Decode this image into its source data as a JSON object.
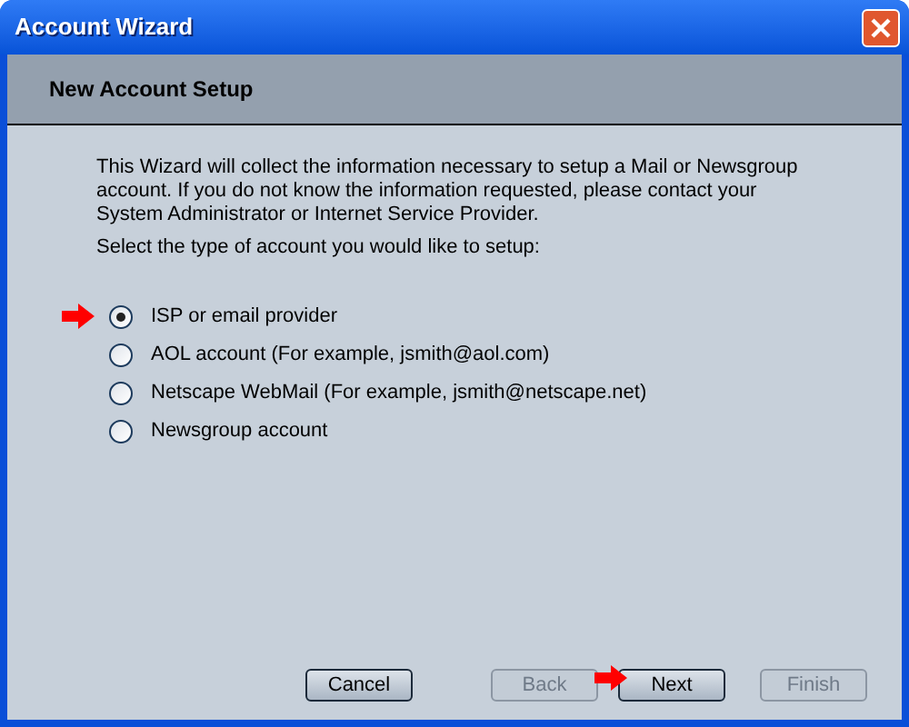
{
  "window": {
    "title": "Account Wizard"
  },
  "header": {
    "title": "New Account Setup"
  },
  "intro": "This Wizard will collect the information necessary to setup a Mail or Newsgroup account. If you do not know the information requested, please contact your System Administrator or Internet Service Provider.",
  "prompt": "Select the type of account you would like to setup:",
  "options": [
    {
      "label": "ISP or email provider",
      "selected": true,
      "pointed": true
    },
    {
      "label": "AOL account (For example, jsmith@aol.com)",
      "selected": false,
      "pointed": false
    },
    {
      "label": "Netscape WebMail (For example, jsmith@netscape.net)",
      "selected": false,
      "pointed": false
    },
    {
      "label": "Newsgroup account",
      "selected": false,
      "pointed": false
    }
  ],
  "buttons": [
    {
      "label": "Cancel",
      "disabled": false,
      "pointed": false
    },
    {
      "label": "Back",
      "disabled": true,
      "pointed": false
    },
    {
      "label": "Next",
      "disabled": false,
      "pointed": true
    },
    {
      "label": "Finish",
      "disabled": true,
      "pointed": false
    }
  ]
}
